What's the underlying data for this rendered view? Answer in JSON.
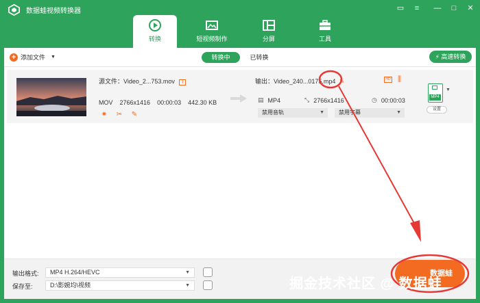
{
  "app": {
    "title": "数据蛙视频转换器"
  },
  "colors": {
    "brand_green": "#2ea35b",
    "accent_orange": "#f26b21",
    "annotation_red": "#e53935"
  },
  "tabs": [
    {
      "label": "转换",
      "icon": "convert-icon",
      "active": true
    },
    {
      "label": "短视频制作",
      "icon": "film-icon",
      "active": false
    },
    {
      "label": "分屏",
      "icon": "split-screen-icon",
      "active": false
    },
    {
      "label": "工具",
      "icon": "toolbox-icon",
      "active": false
    }
  ],
  "subbar": {
    "add_file": "添加文件",
    "converting_tab": "转换中",
    "converted_tab": "已转换",
    "fast_convert": "高速转换"
  },
  "file": {
    "source_label": "源文件：",
    "source_name": "Video_2...753.mov",
    "format": "MOV",
    "resolution": "2766x1416",
    "duration": "00:00:03",
    "size": "442.30 KB",
    "output_label": "输出：",
    "output_name": "Video_240...0175.",
    "output_ext": "mp4",
    "out_format": "MP4",
    "out_resolution": "2766x1416",
    "out_duration": "00:00:03",
    "audio_track": "禁用音轨",
    "subtitle": "禁用字幕",
    "format_badge": "MP4",
    "settings": "设置"
  },
  "bottom": {
    "output_format_label": "输出格式:",
    "output_format_value": "MP4 H.264/HEVC",
    "save_to_label": "保存至:",
    "save_to_value": "D:\\影婉均\\视频",
    "convert_all": "数据蛙"
  },
  "watermark": "掘金技术社区 @ 数据蛙"
}
